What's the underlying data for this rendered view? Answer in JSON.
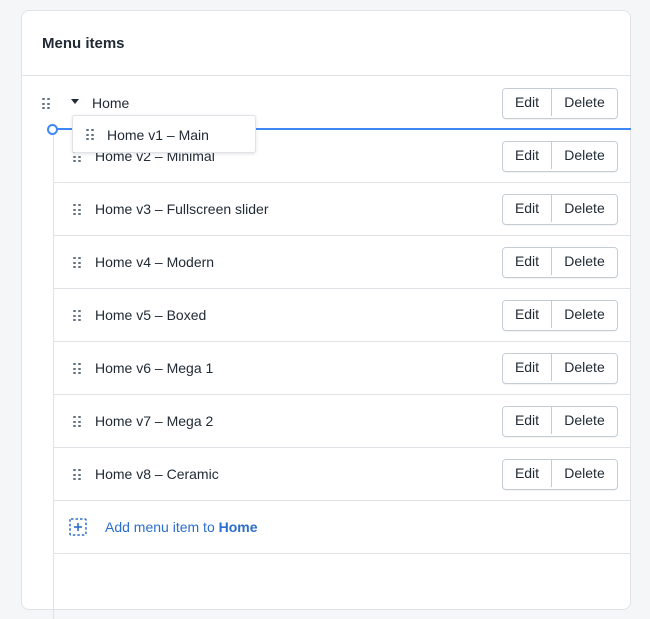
{
  "card": {
    "title": "Menu items"
  },
  "parent_item": {
    "label": "Home",
    "edit_label": "Edit",
    "delete_label": "Delete"
  },
  "dragging_item": {
    "label": "Home v1 – Main"
  },
  "child_items": [
    {
      "label": "Home v2 – Minimal",
      "edit_label": "Edit",
      "delete_label": "Delete"
    },
    {
      "label": "Home v3 – Fullscreen slider",
      "edit_label": "Edit",
      "delete_label": "Delete"
    },
    {
      "label": "Home v4 – Modern",
      "edit_label": "Edit",
      "delete_label": "Delete"
    },
    {
      "label": "Home v5 – Boxed",
      "edit_label": "Edit",
      "delete_label": "Delete"
    },
    {
      "label": "Home v6 – Mega 1",
      "edit_label": "Edit",
      "delete_label": "Delete"
    },
    {
      "label": "Home v7 – Mega 2",
      "edit_label": "Edit",
      "delete_label": "Delete"
    },
    {
      "label": "Home v8 – Ceramic",
      "edit_label": "Edit",
      "delete_label": "Delete"
    }
  ],
  "add_item": {
    "prefix": "Add menu item to ",
    "target": "Home"
  },
  "colors": {
    "accent": "#2c6ecb",
    "drop_indicator": "#3f87f5",
    "border": "#dfe3e8",
    "text": "#212b36"
  },
  "icons": {
    "drag": "drag-handle-icon",
    "caret": "caret-down-icon",
    "add": "add-square-icon"
  }
}
